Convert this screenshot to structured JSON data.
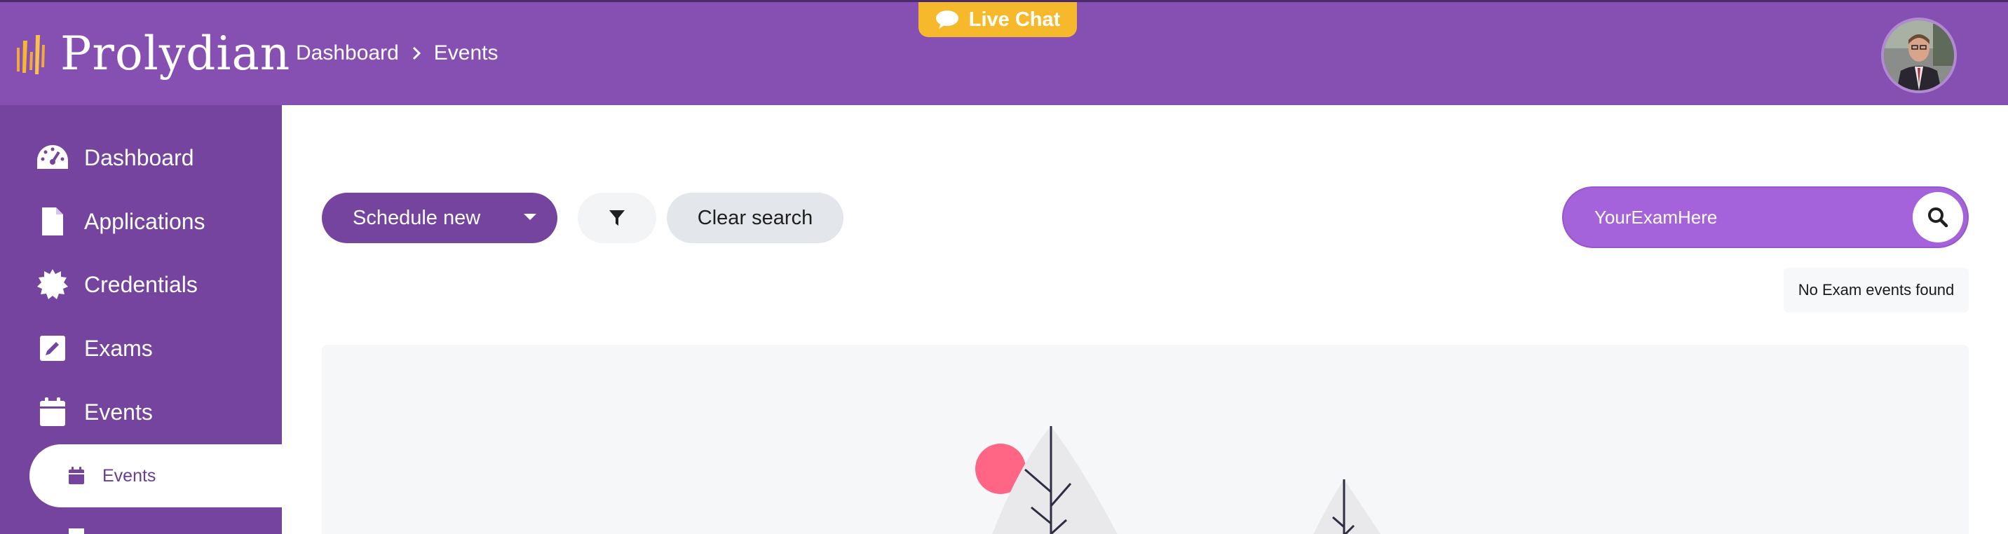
{
  "app": {
    "brand": "Prolydian",
    "colors": {
      "header": "#8650b3",
      "sidebar": "#74449e",
      "accent": "#f7b92c",
      "search": "#a462db"
    }
  },
  "header": {
    "breadcrumb": [
      {
        "label": "Dashboard"
      },
      {
        "label": "Events"
      }
    ],
    "live_chat": {
      "label": "Live Chat",
      "icon": "chat-bubble-icon"
    },
    "avatar": {
      "icon": "user-avatar"
    }
  },
  "sidebar": {
    "items": [
      {
        "label": "Dashboard",
        "icon": "dashboard-gauge-icon"
      },
      {
        "label": "Applications",
        "icon": "file-icon"
      },
      {
        "label": "Credentials",
        "icon": "certificate-icon"
      },
      {
        "label": "Exams",
        "icon": "edit-icon"
      },
      {
        "label": "Events",
        "icon": "calendar-icon"
      }
    ],
    "sub_items": [
      {
        "label": "Events",
        "icon": "calendar-icon",
        "active": true
      }
    ]
  },
  "main": {
    "schedule_button": {
      "label": "Schedule new"
    },
    "filter_button": {
      "icon": "filter-icon"
    },
    "clear_button": {
      "label": "Clear search"
    },
    "search": {
      "value": "YourExamHere",
      "icon": "search-icon"
    },
    "status_message": "No Exam events found",
    "illustration": {
      "icon": "empty-state-trees-illustration"
    }
  }
}
